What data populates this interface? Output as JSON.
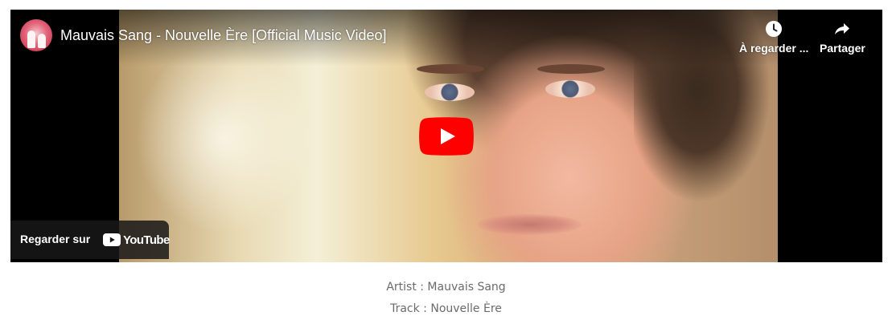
{
  "video": {
    "title": "Mauvais Sang - Nouvelle Ère [Official Music Video]",
    "watch_later_label": "À regarder ...",
    "share_label": "Partager",
    "watch_on_label": "Regarder sur",
    "youtube_wordmark": "YouTube"
  },
  "info": {
    "artist_line": "Artist : Mauvais Sang",
    "track_line": "Track : Nouvelle Ère"
  },
  "colors": {
    "play_button": "#ff0000",
    "overlay_text": "#ffffff",
    "meta_text": "#6b6b6b"
  },
  "icons": {
    "watch_later": "clock-icon",
    "share": "share-arrow-icon",
    "play": "play-icon",
    "youtube_logo": "youtube-logo-icon"
  }
}
